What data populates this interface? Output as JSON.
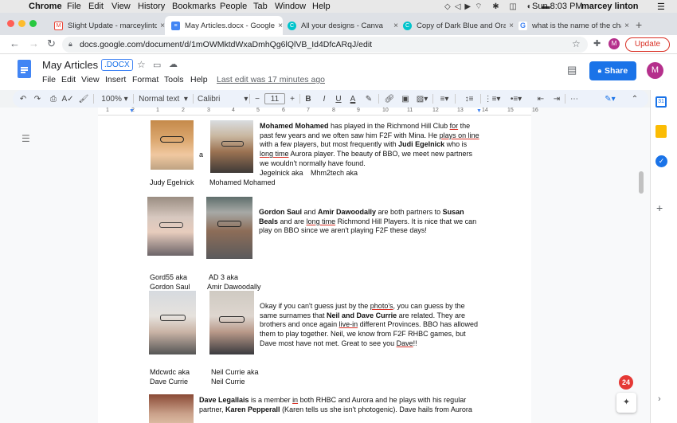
{
  "menubar": {
    "apple": "",
    "app": "Chrome",
    "items": [
      "File",
      "Edit",
      "View",
      "History",
      "Bookmarks",
      "People",
      "Tab",
      "Window",
      "Help"
    ],
    "clock": "Sun 8:03 PM",
    "user": "marcey linton"
  },
  "tabs": [
    {
      "label": "Slight Update - marceylinto",
      "favicon": "gmail-icon",
      "color": "#ea4335",
      "active": false
    },
    {
      "label": "May Articles.docx - Google",
      "favicon": "docs-icon",
      "color": "#4285f4",
      "active": true
    },
    {
      "label": "All your designs - Canva",
      "favicon": "canva-icon",
      "color": "#00c4cc",
      "active": false
    },
    {
      "label": "Copy of Dark Blue and Oran",
      "favicon": "canva-icon",
      "color": "#00c4cc",
      "active": false
    },
    {
      "label": "what is the name of the cha",
      "favicon": "google-icon",
      "color": "#ffffff",
      "active": false
    }
  ],
  "address": {
    "url": "docs.google.com/document/d/1mOWMktdWxaDmhQg6lQlVB_Id4DfcARqJ/edit",
    "profile_initial": "M",
    "update_label": "Update"
  },
  "doc": {
    "title": "May Articles",
    "ext": ".DOCX",
    "menus": [
      "File",
      "Edit",
      "View",
      "Insert",
      "Format",
      "Tools",
      "Help"
    ],
    "last_edit": "Last edit was 17 minutes ago",
    "share_label": "Share",
    "avatar": "M"
  },
  "toolbar": {
    "zoom": "100%",
    "style": "Normal text",
    "font": "Calibri",
    "size": "11"
  },
  "ruler": {
    "numbers": [
      "1",
      "2",
      "1",
      "2",
      "3",
      "4",
      "5",
      "6",
      "7",
      "8",
      "9",
      "10",
      "11",
      "12",
      "13",
      "14",
      "15",
      "16",
      "17",
      "18",
      "19"
    ]
  },
  "content": {
    "s1": {
      "bold": "Mohamed Mohamed",
      "l1": " has played in the Richmond Hill Club ",
      "u1": "for",
      "l2": "the past few years and we often saw him F2F with Mina.  He ",
      "u2": "plays on line",
      "l3": " with a few players, but most frequently with ",
      "b2": "Judi Egelnick",
      "l4": " who is ",
      "u3": "long time",
      "l5": " Aurora player.  The beauty of BBO, we meet new partners we wouldn't normally have found.",
      "a1": "Jegelnick aka",
      "a2": "Mhm2tech aka",
      "stray": "a",
      "cap1": "Judy Egelnick",
      "cap2": "Mohamed Mohamed"
    },
    "s2": {
      "b1": "Gordon Saul",
      "t1": " and ",
      "b2": "Amir Dawoodally",
      "t2": " are both partners to ",
      "b3": "Susan Beals",
      "t3": " and are ",
      "u1": "long time",
      "t4": " Richmond Hill Players.  It is nice that we can play on BBO since we aren't playing F2F these days!",
      "c1a": "Gord55 aka",
      "c1b": "Gordon Saul",
      "c2a": "AD   3 aka",
      "c2b": "Amir Dawoodally"
    },
    "s3": {
      "t1": "Okay if you can't guess just by the ",
      "u1": "photo's",
      "t2": ", you can guess by the same surnames that ",
      "b1": "Neil and Dave Currie",
      "t3": " are related.  They are brothers and once again ",
      "u2": "live-in",
      "t4": " different Provinces. BBO has allowed them to play together. Neil, we know from F2F RHBC games, but Dave most have not met. Great to see you ",
      "u3": "Dave",
      "t5": "!!",
      "c1a": "Mdcwdc aka",
      "c1b": "Dave Currie",
      "c2a": "Neil Currie aka",
      "c2b": "Neil Currie"
    },
    "s4": {
      "b1": "Dave Legallais",
      "t1": " is a member ",
      "u1": "in",
      "t2": " both RHBC and Aurora and he plays with his regular partner, ",
      "b2": "Karen Pepperall",
      "t3": " (Karen tells us she isn't photogenic).  Dave hails from Aurora"
    }
  },
  "side": {
    "badge": "24"
  }
}
